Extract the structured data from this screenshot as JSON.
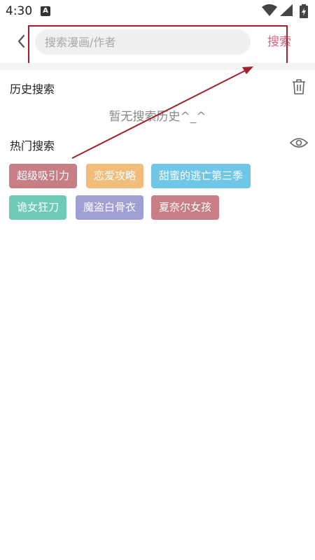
{
  "status_bar": {
    "time": "4:30",
    "app_icon": "A",
    "icons": [
      "wifi-icon",
      "signal-icon",
      "battery-charging-icon"
    ]
  },
  "header": {
    "back_icon": "chevron-left-icon",
    "search_placeholder": "搜索漫画/作者",
    "search_button": "搜索"
  },
  "history": {
    "title": "历史搜索",
    "clear_icon": "trash-icon",
    "empty_text": "暂无搜索历史^_^"
  },
  "hot": {
    "title": "热门搜索",
    "toggle_icon": "eye-icon",
    "tags": [
      {
        "label": "超级吸引力",
        "color": "#c97e86"
      },
      {
        "label": "恋爱攻略",
        "color": "#f2bd7b"
      },
      {
        "label": "甜蜜的逃亡第三季",
        "color": "#6fc6e7"
      },
      {
        "label": "诡女狂刀",
        "color": "#6dcbb8"
      },
      {
        "label": "魔盗白骨衣",
        "color": "#a09fd4"
      },
      {
        "label": "夏奈尔女孩",
        "color": "#c97e86"
      }
    ]
  },
  "colors": {
    "accent": "#e0607e",
    "annotation": "#a3202c"
  }
}
